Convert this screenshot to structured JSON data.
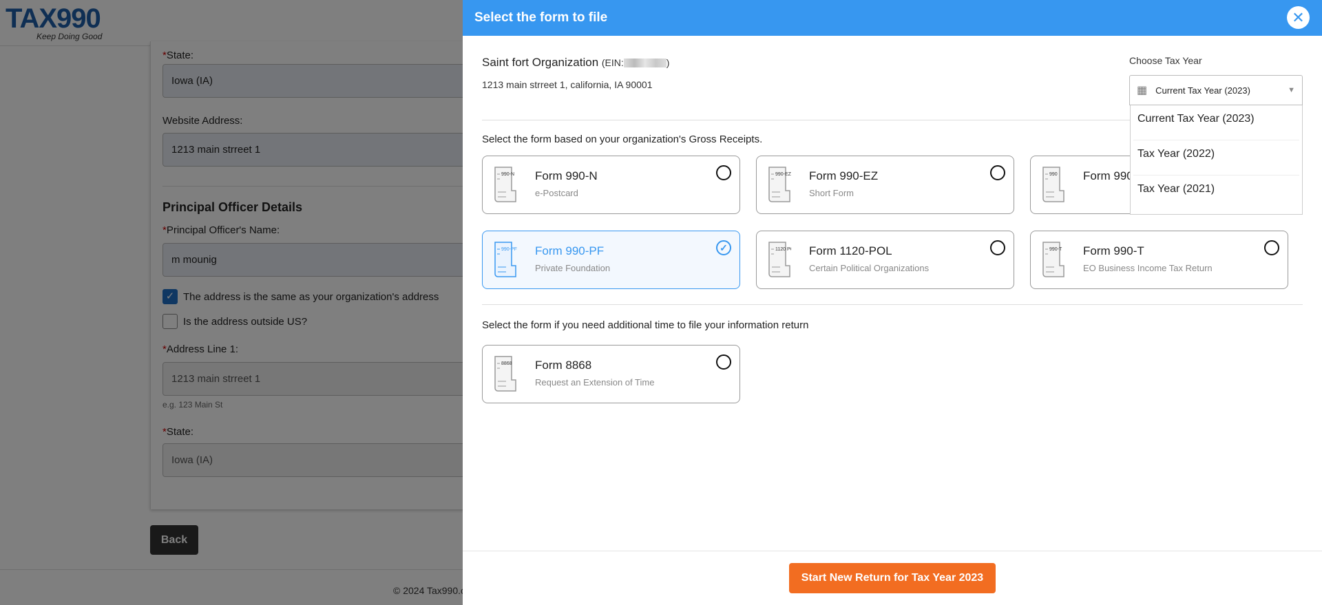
{
  "logo": {
    "text": "TAX990",
    "tagline": "Keep Doing Good"
  },
  "form": {
    "state_label": "State:",
    "state_value": "Iowa (IA)",
    "website_label": "Website Address:",
    "website_value": "1213 main strreet 1",
    "section": "Principal Officer Details",
    "officer_label": "Principal Officer's Name:",
    "officer_value": "m mounig",
    "same_address": "The address is the same as your organization's address",
    "outside_us": "Is the address outside US?",
    "address1_label": "Address Line 1:",
    "address1_value": "1213 main strreet 1",
    "address1_hint": "e.g. 123 Main St",
    "state2_label": "State:",
    "state2_value": "Iowa (IA)",
    "back": "Back"
  },
  "footer": "© 2024 Tax990.c",
  "panel": {
    "title": "Select the form to file",
    "close": "✕",
    "org_name": "Saint fort Organization",
    "ein_label": "(EIN:",
    "org_address": "1213 main strreet 1, california, IA 90001",
    "tax_year_label": "Choose Tax Year",
    "tax_year_selected": "Current Tax Year (2023)",
    "tax_year_options": [
      "Current Tax Year (2023)",
      "Tax Year (2022)",
      "Tax Year (2021)"
    ],
    "gross_text": "Select the form based on your organization's Gross Receipts.",
    "ext_text": "Select the form if you need additional time to file your information return",
    "forms": [
      {
        "code": "990-N",
        "name": "Form 990-N",
        "sub": "e-Postcard",
        "selected": false
      },
      {
        "code": "990-EZ",
        "name": "Form 990-EZ",
        "sub": "Short Form",
        "selected": false
      },
      {
        "code": "990",
        "name": "Form 990",
        "sub": "",
        "selected": false
      },
      {
        "code": "990-PF",
        "name": "Form 990-PF",
        "sub": "Private Foundation",
        "selected": true
      },
      {
        "code": "1120 POL",
        "name": "Form 1120-POL",
        "sub": "Certain Political Organizations",
        "selected": false
      },
      {
        "code": "990-T",
        "name": "Form 990-T",
        "sub": "EO Business Income Tax Return",
        "selected": false
      },
      {
        "code": "8868",
        "name": "Form 8868",
        "sub": "Request an Extension of Time",
        "selected": false
      }
    ],
    "start_button": "Start New Return for Tax Year 2023"
  },
  "colors": {
    "primary": "#3797f0",
    "accent": "#f26d21"
  }
}
